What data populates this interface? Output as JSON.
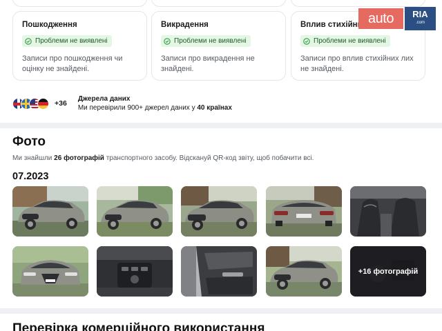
{
  "cards": [
    {
      "title": "Пошкодження",
      "badge": "Проблеми не виявлені",
      "description": "Записи про пошкодження чи оцінку не знайдені."
    },
    {
      "title": "Викрадення",
      "badge": "Проблеми не виявлені",
      "description": "Записи про викрадення не знайдені."
    },
    {
      "title": "Вплив стихійних лих",
      "badge": "Проблеми не виявлені",
      "description": "Записи про вплив стихійних лих не знайдені."
    }
  ],
  "logo": {
    "part1": "auto",
    "part2": "RIA",
    "domain": ".com",
    "brand_colors": {
      "auto": "#e56a5f",
      "ria": "#2b4f82"
    }
  },
  "sources": {
    "flags": [
      "uk-flag-icon",
      "sweden-flag-icon",
      "usa-flag-icon",
      "germany-flag-icon"
    ],
    "extra_count": "+36",
    "title": "Джерела даних",
    "subtitle_prefix": "Ми перевірили 900+ джерел даних у ",
    "subtitle_bold": "40 країнах"
  },
  "photos": {
    "title": "Фото",
    "sub_prefix": "Ми знайшли ",
    "sub_bold": "26 фотографій",
    "sub_suffix": " транспортного засобу. Відскануй QR-код звіту, щоб побачити всі.",
    "date": "07.2023",
    "more_label": "+16 фотографій",
    "thumbnails": [
      "car-front-three-quarter-photo",
      "car-front-three-quarter-photo",
      "car-front-three-quarter-photo",
      "car-rear-photo",
      "car-interior-seats-photo",
      "car-front-photo",
      "car-center-console-photo",
      "car-door-panel-photo",
      "car-front-three-quarter-photo",
      "car-interior-detail-photo"
    ]
  },
  "next_section": {
    "title": "Перевірка комерційного використання"
  },
  "colors": {
    "badge_bg": "#e4f6e4",
    "badge_text": "#1f5b2a",
    "badge_icon": "#2e9b46",
    "car_body": "#8f9189"
  }
}
